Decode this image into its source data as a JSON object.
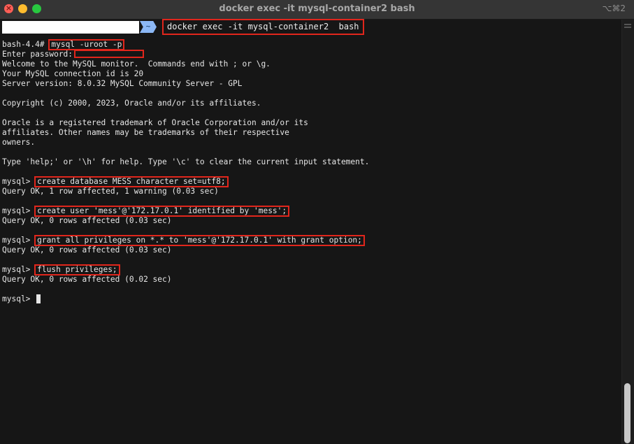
{
  "window": {
    "title": "docker exec -it mysql-container2 bash",
    "shortcut": "⌥⌘2"
  },
  "prompt_bar": {
    "path": "~",
    "command": "docker exec -it mysql-container2  bash"
  },
  "terminal": {
    "bash_prompt": "bash-4.4# ",
    "login_command": "mysql -uroot -p",
    "password_prompt": "Enter password:",
    "welcome": [
      "Welcome to the MySQL monitor.  Commands end with ; or \\g.",
      "Your MySQL connection id is 20",
      "Server version: 8.0.32 MySQL Community Server - GPL"
    ],
    "copyright": "Copyright (c) 2000, 2023, Oracle and/or its affiliates.",
    "trademark": [
      "Oracle is a registered trademark of Oracle Corporation and/or its",
      "affiliates. Other names may be trademarks of their respective",
      "owners."
    ],
    "help": "Type 'help;' or '\\h' for help. Type '\\c' to clear the current input statement.",
    "mysql_prompt": "mysql> ",
    "commands": [
      {
        "sql": "create database MESS character set=utf8;",
        "result": "Query OK, 1 row affected, 1 warning (0.03 sec)"
      },
      {
        "sql": "create user 'mess'@'172.17.0.1' identified by 'mess';",
        "result": "Query OK, 0 rows affected (0.03 sec)"
      },
      {
        "sql": "grant all privileges on *.* to 'mess'@'172.17.0.1' with grant option;",
        "result": "Query OK, 0 rows affected (0.03 sec)"
      },
      {
        "sql": "flush privileges;",
        "result": "Query OK, 0 rows affected (0.02 sec)"
      }
    ]
  },
  "colors": {
    "highlight_border": "#e1261c",
    "background": "#161616",
    "text": "#e6e6e6",
    "path_segment": "#8cb8f5"
  }
}
